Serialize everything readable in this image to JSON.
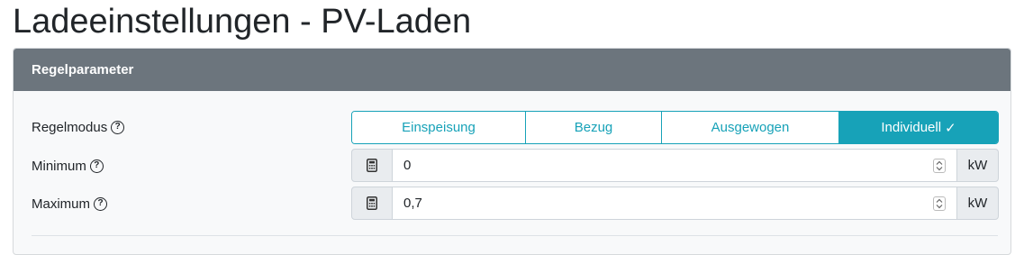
{
  "page": {
    "title": "Ladeeinstellungen - PV-Laden"
  },
  "card": {
    "header": "Regelparameter"
  },
  "regelmodus": {
    "label": "Regelmodus",
    "options": [
      "Einspeisung",
      "Bezug",
      "Ausgewogen",
      "Individuell"
    ],
    "selected": "Individuell"
  },
  "minimum": {
    "label": "Minimum",
    "value": "0",
    "unit": "kW"
  },
  "maximum": {
    "label": "Maximum",
    "value": "0,7",
    "unit": "kW"
  },
  "icons": {
    "help": "question-circle-icon",
    "calculator": "calculator-icon",
    "check": "check-icon",
    "spinner": "spinner-arrows-icon"
  },
  "colors": {
    "header_bg": "#6c757d",
    "accent": "#17a2b8"
  }
}
